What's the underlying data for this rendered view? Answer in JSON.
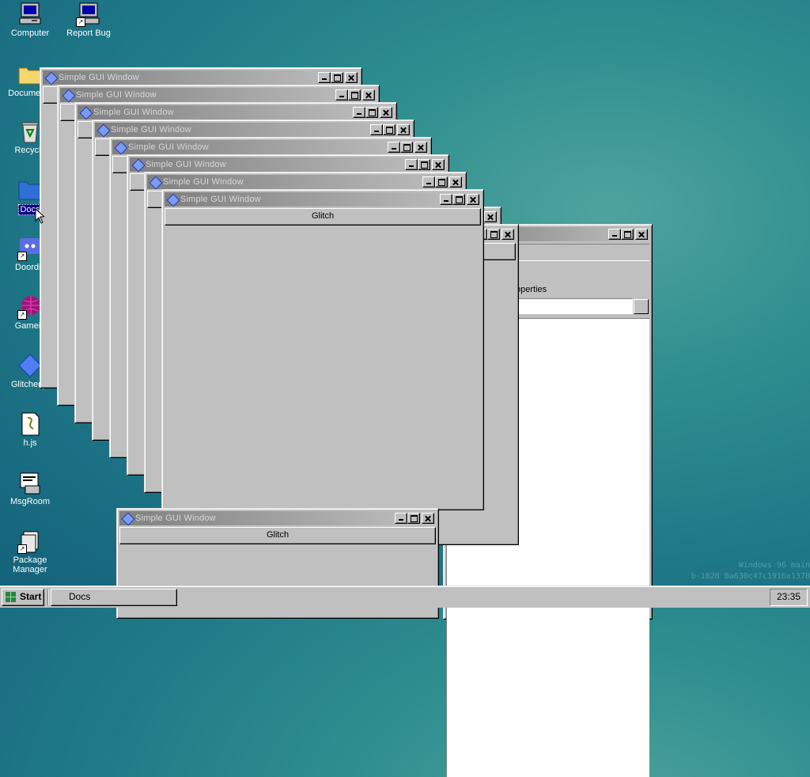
{
  "desktop": {
    "icons": [
      {
        "label": "Computer"
      },
      {
        "label": "Report Bug"
      },
      {
        "label": "Documents"
      },
      {
        "label": "Recycle"
      },
      {
        "label": "Docs"
      },
      {
        "label": "Doordis"
      },
      {
        "label": "Gamein"
      },
      {
        "label": "Glitcher.js"
      },
      {
        "label": "h.js"
      },
      {
        "label": "MsgRoom"
      },
      {
        "label": "Package Manager"
      }
    ]
  },
  "windows": {
    "title": "Simple GUI Window",
    "button_label": "Glitch"
  },
  "explorer": {
    "properties_label": "Properties"
  },
  "watermark": {
    "line1": "Windows 96 main",
    "line2": "b-1828 0a630c47c1916a1378"
  },
  "taskbar": {
    "start_label": "Start",
    "task_label": "Docs",
    "clock": "23:35"
  }
}
